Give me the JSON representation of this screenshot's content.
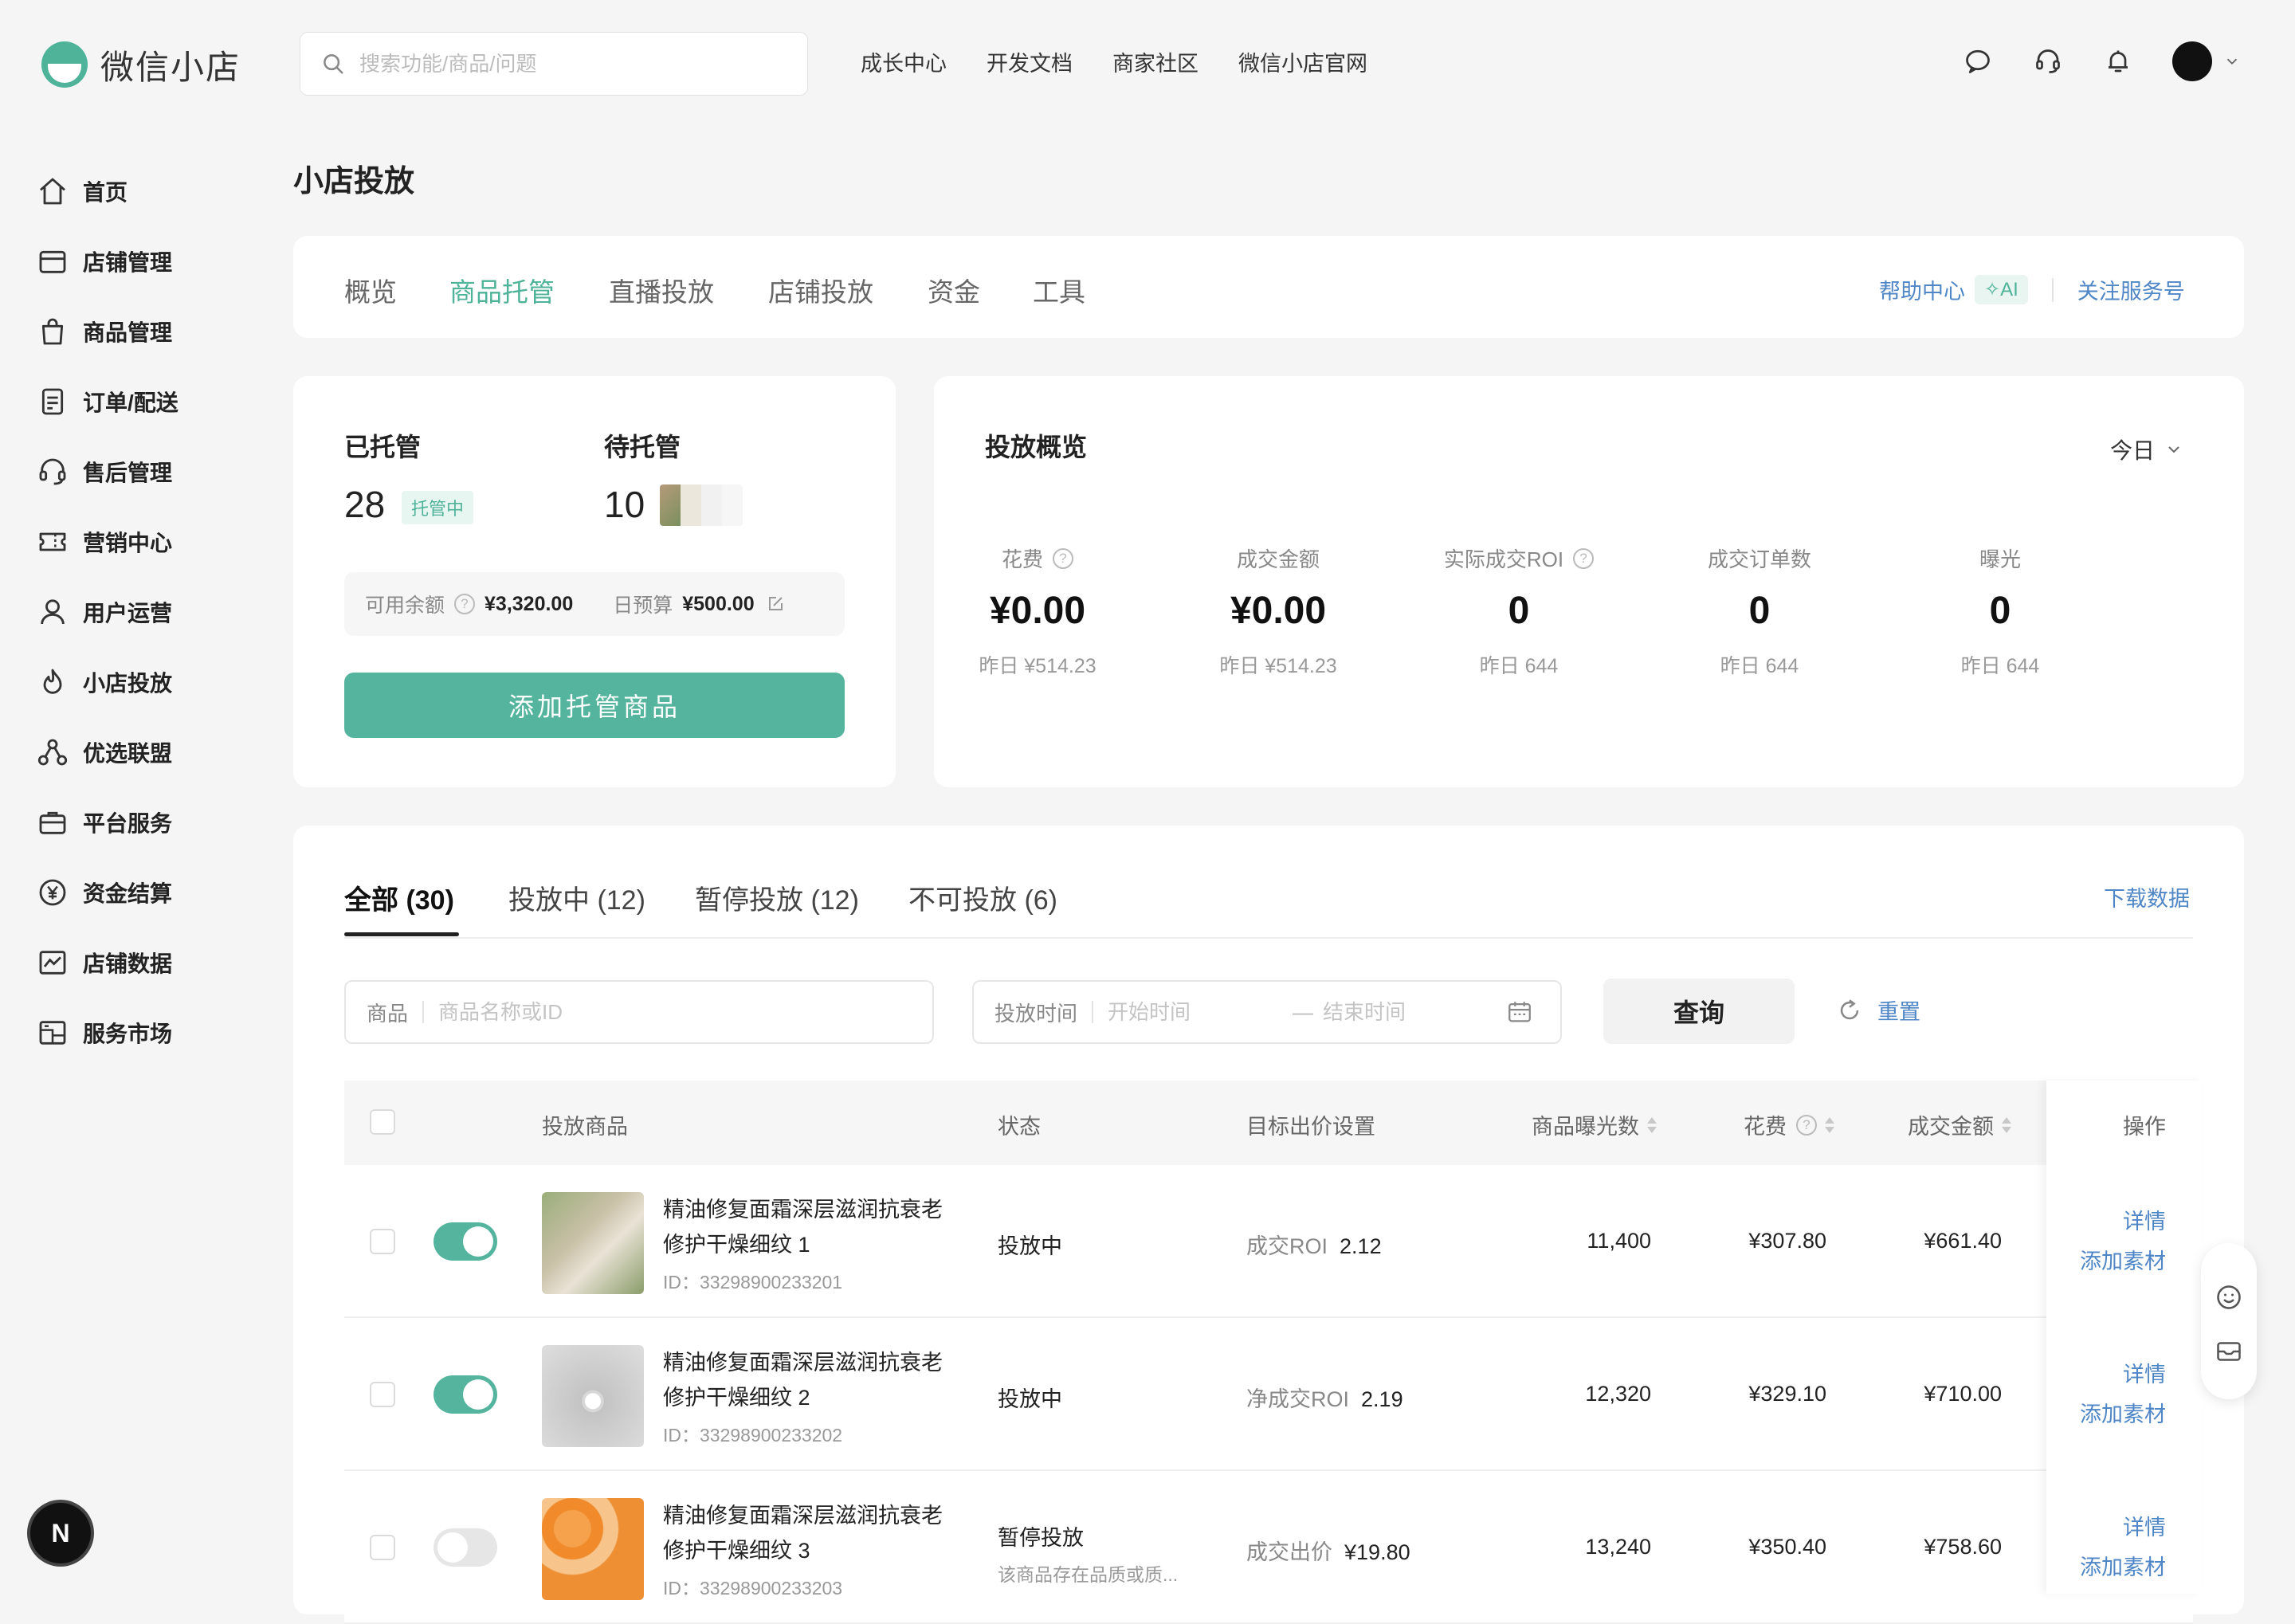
{
  "brand": {
    "name": "微信小店",
    "accent": "#4eb398"
  },
  "search": {
    "placeholder": "搜索功能/商品/问题"
  },
  "topnav": [
    "成长中心",
    "开发文档",
    "商家社区",
    "微信小店官网"
  ],
  "sidebar": {
    "items": [
      {
        "label": "首页",
        "icon": "home-icon"
      },
      {
        "label": "店铺管理",
        "icon": "store-icon"
      },
      {
        "label": "商品管理",
        "icon": "bag-icon"
      },
      {
        "label": "订单/配送",
        "icon": "order-icon"
      },
      {
        "label": "售后管理",
        "icon": "headset-icon"
      },
      {
        "label": "营销中心",
        "icon": "coupon-icon"
      },
      {
        "label": "用户运营",
        "icon": "user-icon"
      },
      {
        "label": "小店投放",
        "icon": "flame-icon"
      },
      {
        "label": "优选联盟",
        "icon": "network-icon"
      },
      {
        "label": "平台服务",
        "icon": "briefcase-icon"
      },
      {
        "label": "资金结算",
        "icon": "yen-icon"
      },
      {
        "label": "店铺数据",
        "icon": "chart-icon"
      },
      {
        "label": "服务市场",
        "icon": "market-icon"
      }
    ]
  },
  "page": {
    "title": "小店投放"
  },
  "tabs": [
    "概览",
    "商品托管",
    "直播投放",
    "店铺投放",
    "资金",
    "工具"
  ],
  "active_tab": "商品托管",
  "help": {
    "help_center": "帮助中心",
    "ai": "AI",
    "follow": "关注服务号"
  },
  "hosting": {
    "managed_label": "已托管",
    "managed_count": "28",
    "managed_badge": "托管中",
    "pending_label": "待托管",
    "pending_count": "10",
    "balance_label": "可用余额",
    "balance_value": "¥3,320.00",
    "budget_label": "日预算",
    "budget_value": "¥500.00",
    "add_button": "添加托管商品"
  },
  "overview": {
    "title": "投放概览",
    "period": "今日",
    "metrics": [
      {
        "label": "花费",
        "value": "¥0.00",
        "yesterday": "昨日 ¥514.23",
        "help": true
      },
      {
        "label": "成交金额",
        "value": "¥0.00",
        "yesterday": "昨日 ¥514.23",
        "help": false
      },
      {
        "label": "实际成交ROI",
        "value": "0",
        "yesterday": "昨日 644",
        "help": true
      },
      {
        "label": "成交订单数",
        "value": "0",
        "yesterday": "昨日 644",
        "help": false
      },
      {
        "label": "曝光",
        "value": "0",
        "yesterday": "昨日 644",
        "help": false
      }
    ]
  },
  "list": {
    "tabs": [
      "全部 (30)",
      "投放中 (12)",
      "暂停投放 (12)",
      "不可投放 (6)"
    ],
    "download": "下载数据",
    "filter": {
      "product_label": "商品",
      "product_placeholder": "商品名称或ID",
      "time_label": "投放时间",
      "start_placeholder": "开始时间",
      "dash": "—",
      "end_placeholder": "结束时间",
      "query": "查询",
      "reset": "重置"
    },
    "columns": [
      "投放商品",
      "状态",
      "目标出价设置",
      "商品曝光数",
      "花费",
      "成交金额",
      "操作"
    ],
    "rows": [
      {
        "name": "精油修复面霜深层滋润抗衰老修护干燥细纹 1",
        "id": "ID：33298900233201",
        "enabled": true,
        "status": "投放中",
        "status_note": "",
        "bid_type": "成交ROI",
        "bid_value": "2.12",
        "impressions": "11,400",
        "cost": "¥307.80",
        "gmv": "¥661.40"
      },
      {
        "name": "精油修复面霜深层滋润抗衰老修护干燥细纹 2",
        "id": "ID：33298900233202",
        "enabled": true,
        "status": "投放中",
        "status_note": "",
        "bid_type": "净成交ROI",
        "bid_value": "2.19",
        "impressions": "12,320",
        "cost": "¥329.10",
        "gmv": "¥710.00"
      },
      {
        "name": "精油修复面霜深层滋润抗衰老修护干燥细纹 3",
        "id": "ID：33298900233203",
        "enabled": false,
        "status": "暂停投放",
        "status_note": "该商品存在品质或质...",
        "bid_type": "成交出价",
        "bid_value": "¥19.80",
        "impressions": "13,240",
        "cost": "¥350.40",
        "gmv": "¥758.60"
      }
    ],
    "ops": {
      "detail": "详情",
      "add_material": "添加素材"
    }
  },
  "fab": {
    "label": "N"
  }
}
